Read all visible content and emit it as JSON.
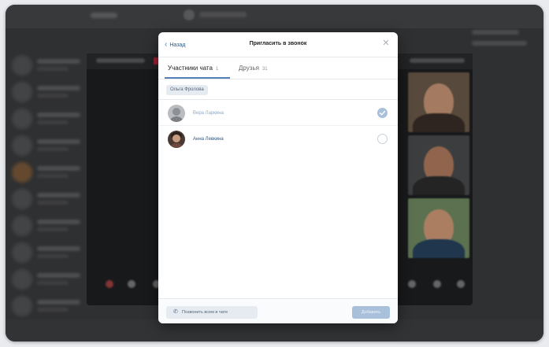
{
  "modal": {
    "back_label": "Назад",
    "title": "Пригласить в звонок",
    "close_icon": "close-icon",
    "tabs": [
      {
        "label": "Участники чата",
        "count": "1"
      },
      {
        "label": "Друзья",
        "count": "31"
      }
    ],
    "selected_chip": "Ольга Фролова",
    "members": [
      {
        "name": "Вера Ларкина",
        "checked": true
      },
      {
        "name": "Анна Левкина",
        "checked": false
      }
    ],
    "footer": {
      "call_all_label": "Позвонить всем в чате",
      "add_label": "Добавить"
    }
  },
  "colors": {
    "accent": "#5181b8",
    "link": "#2a5885",
    "disabled_button": "#a9c0da",
    "chip_bg": "#e5ebf1",
    "backdrop": "#3a3b3d"
  }
}
